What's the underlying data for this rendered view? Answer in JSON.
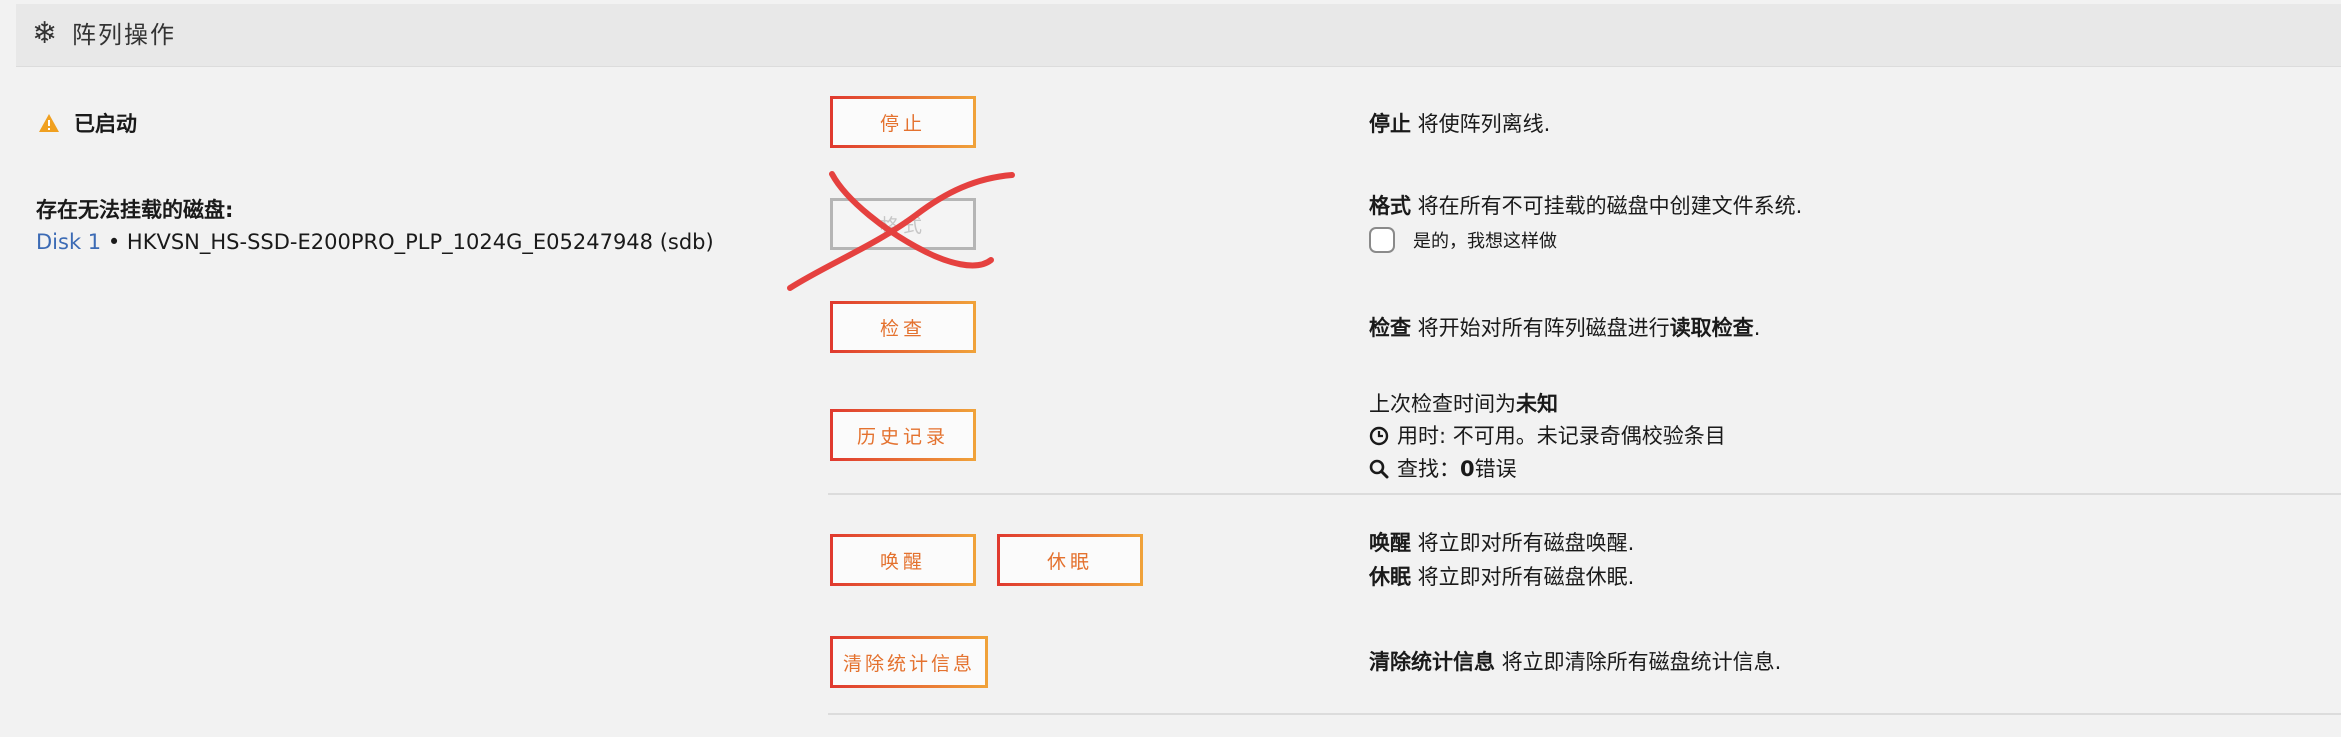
{
  "header": {
    "icon": "snowflake-icon",
    "title": "阵列操作"
  },
  "status": {
    "icon": "warning-icon",
    "label": "已启动"
  },
  "unmountable": {
    "heading": "存在无法挂载的磁盘:",
    "disk_link": "Disk 1",
    "separator": "•",
    "disk_id": "HKVSN_HS-SSD-E200PRO_PLP_1024G_E05247948 (sdb)"
  },
  "buttons": {
    "stop": "停止",
    "format": "格式",
    "check": "检查",
    "history": "历史记录",
    "spinup": "唤醒",
    "spindown": "休眠",
    "clear_stats": "清除统计信息"
  },
  "desc": {
    "stop_bold": "停止",
    "stop_text": " 将使阵列离线.",
    "format_bold": "格式",
    "format_text": " 将在所有不可挂载的磁盘中创建文件系统.",
    "format_confirm": "是的，我想这样做",
    "check_bold": "检查",
    "check_text": " 将开始对所有阵列磁盘进行",
    "check_bold2": "读取检查",
    "check_end": ".",
    "last_check_text": "上次检查时间为",
    "last_check_bold": "未知",
    "duration_icon": "clock-icon",
    "duration_text": "用时: 不可用。未记录奇偶校验条目",
    "found_icon": "search-icon",
    "found_label": "查找：",
    "found_count": "0",
    "found_text": "错误",
    "spinup_bold": "唤醒",
    "spinup_text": " 将立即对所有磁盘唤醒.",
    "spindown_bold": "休眠",
    "spindown_text": " 将立即对所有磁盘休眠.",
    "clear_bold": "清除统计信息",
    "clear_text": " 将立即清除所有磁盘统计信息."
  },
  "annotation": {
    "icon": "red-cross-mark-icon",
    "color": "#e5413f"
  },
  "colors": {
    "accent": "#e4722f",
    "border_start": "#e03a2f",
    "border_end": "#f0a23a",
    "link": "#3c6bb5",
    "warning": "#f0a020"
  }
}
